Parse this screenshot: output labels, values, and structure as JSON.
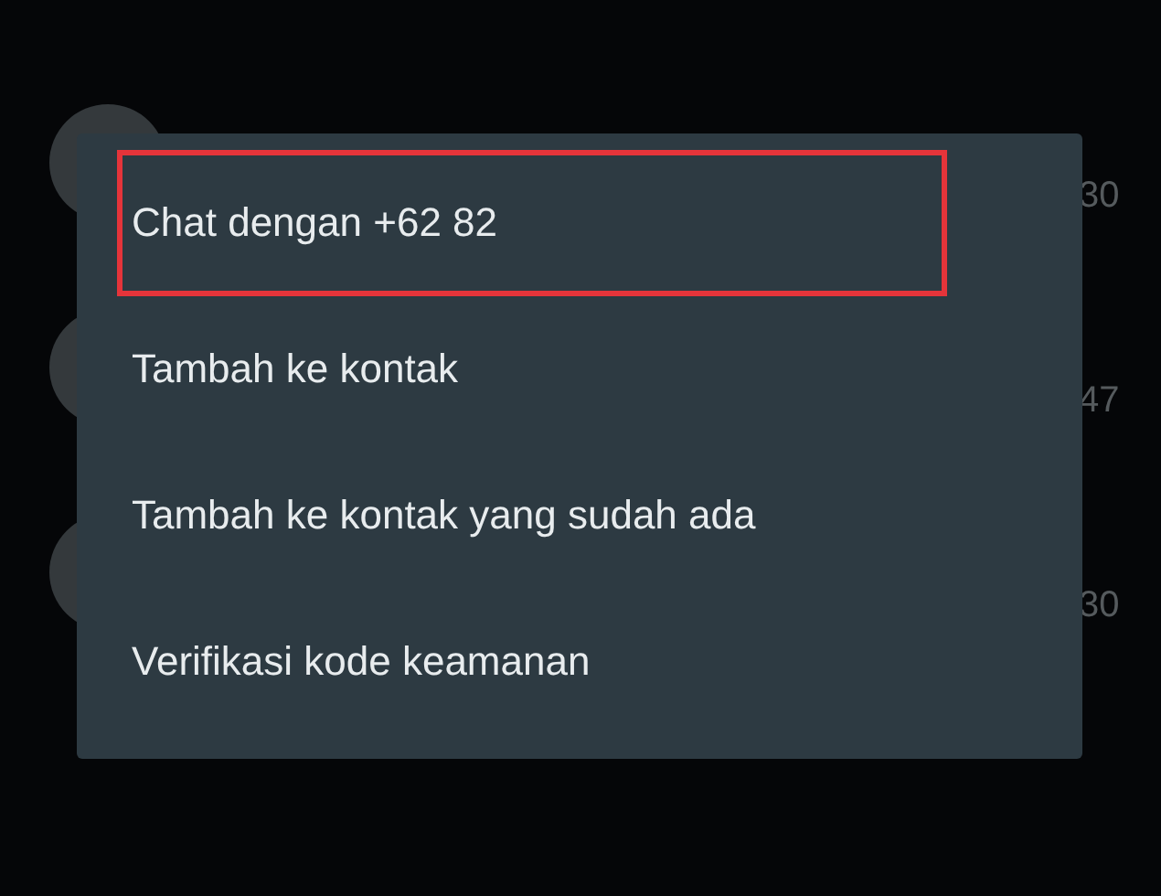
{
  "chats": [
    {
      "time": "30"
    },
    {
      "time": "47"
    },
    {
      "time": "30"
    }
  ],
  "menu": {
    "items": [
      {
        "label": "Chat dengan +62 82",
        "highlighted": true
      },
      {
        "label": "Tambah ke kontak",
        "highlighted": false
      },
      {
        "label": "Tambah ke kontak yang sudah ada",
        "highlighted": false
      },
      {
        "label": "Verifikasi kode keamanan",
        "highlighted": false
      }
    ]
  }
}
